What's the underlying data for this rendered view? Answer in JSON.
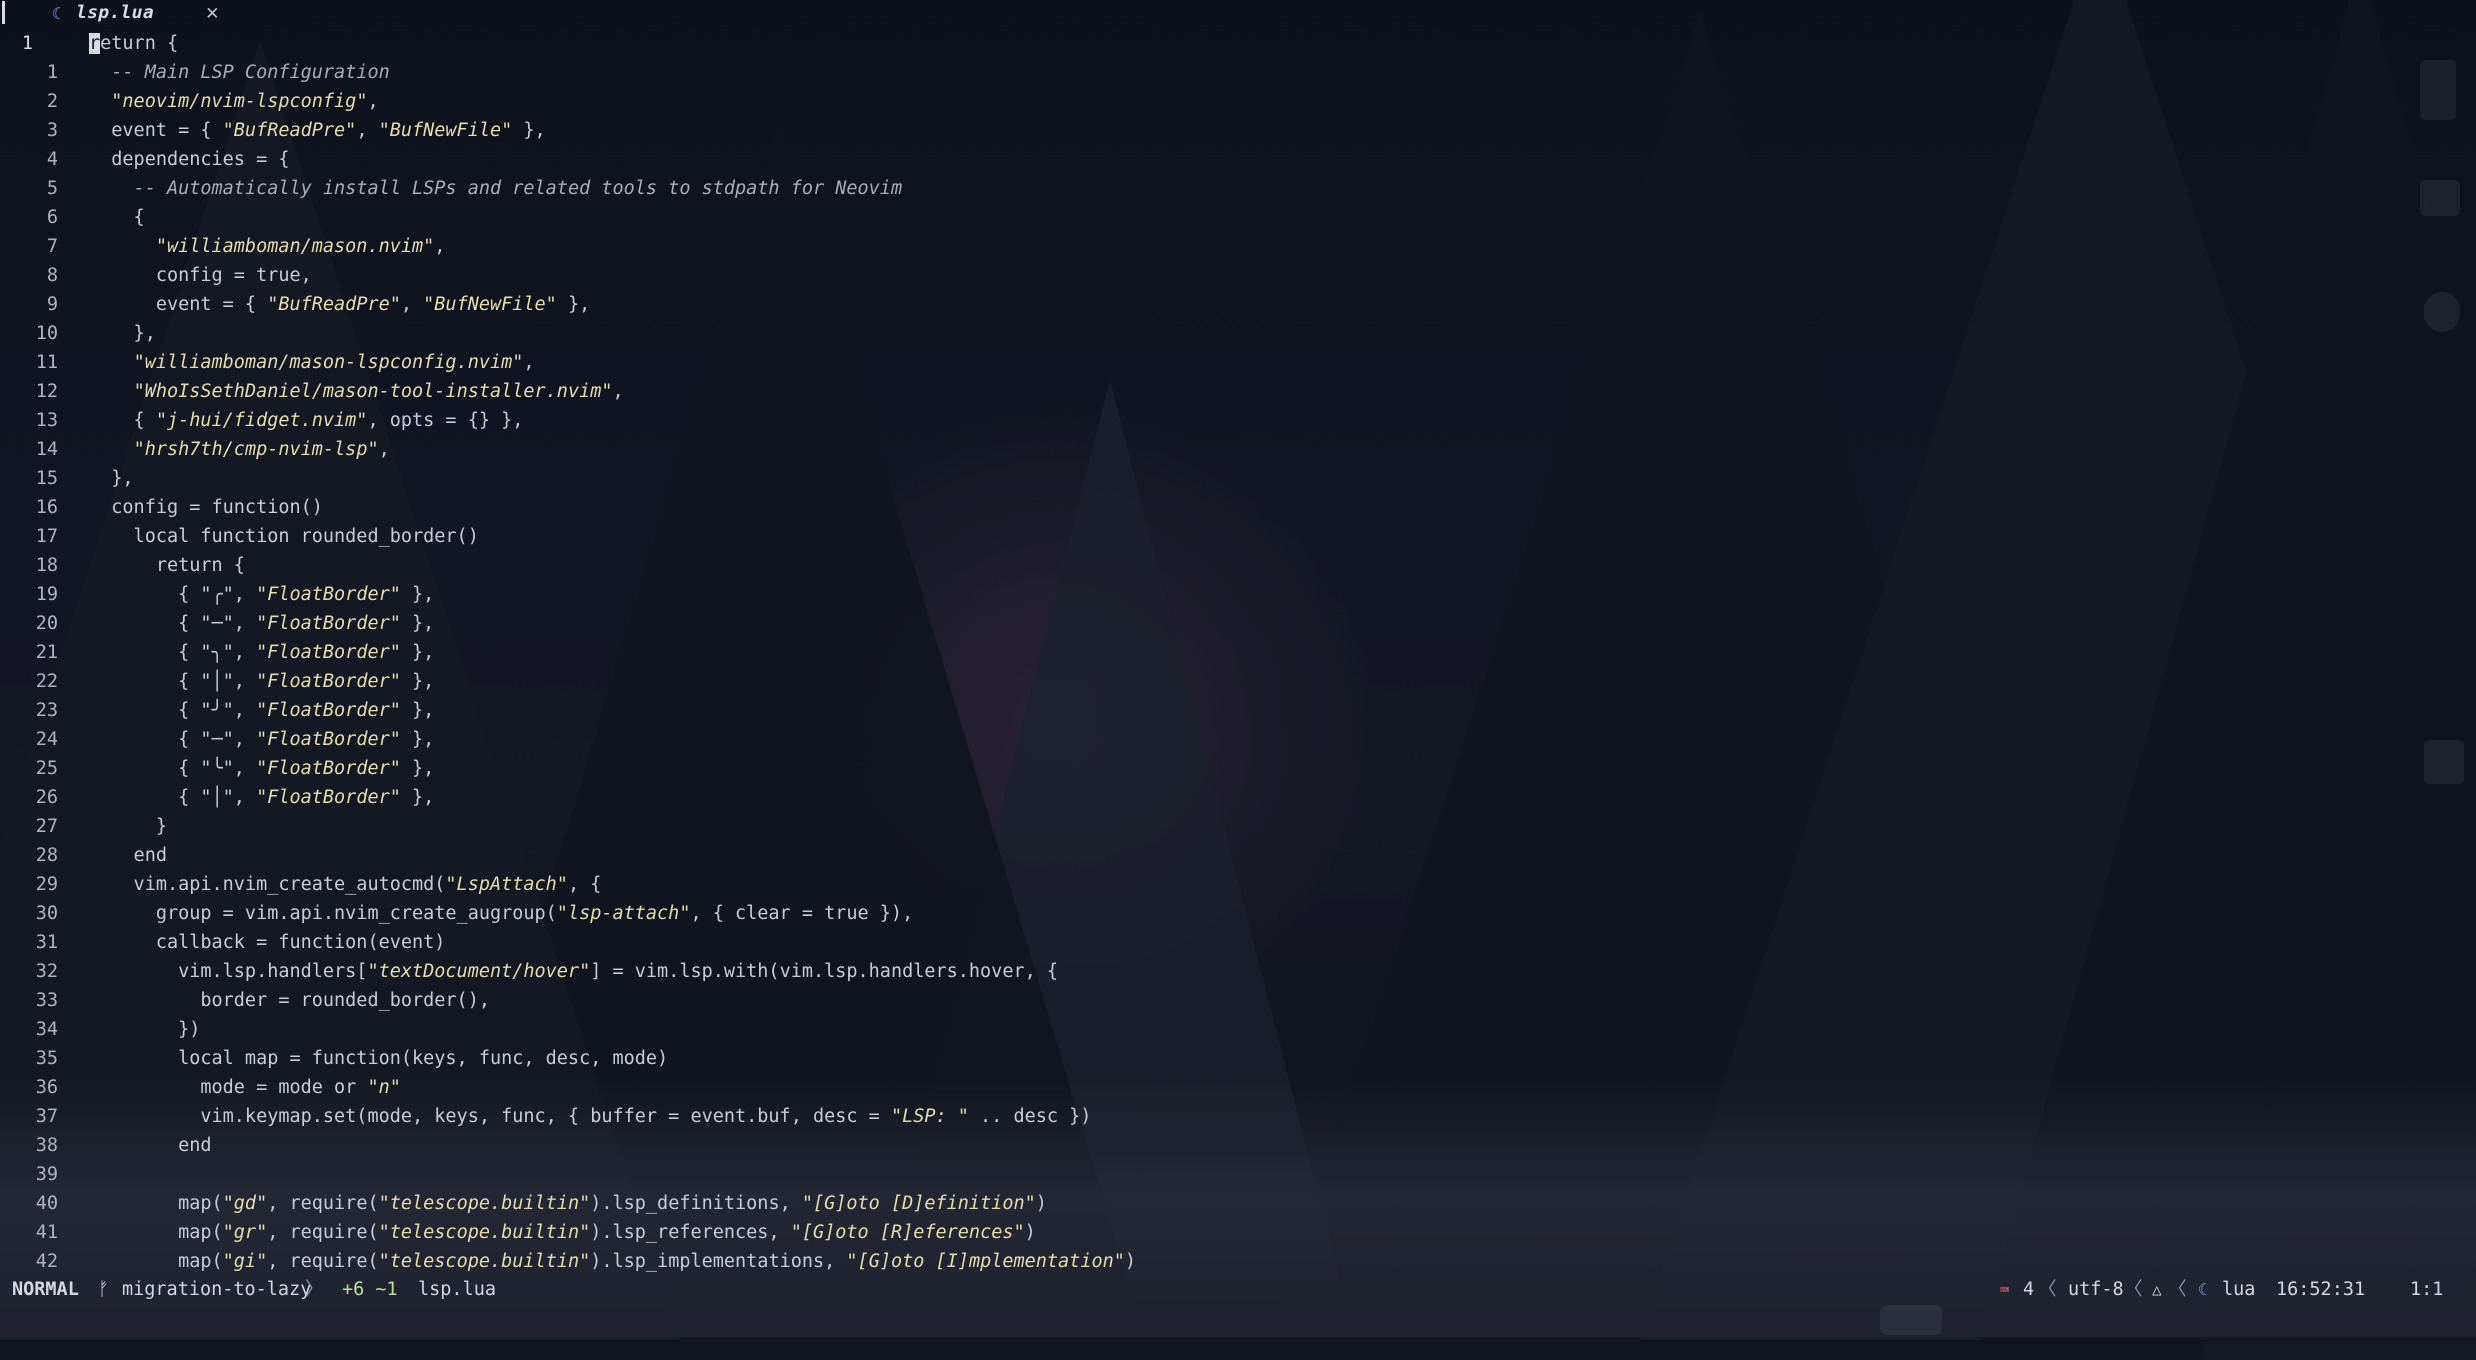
{
  "tab": {
    "icon": "lua-file-icon",
    "label": "lsp.lua",
    "close": "✕"
  },
  "editor": {
    "lines": [
      {
        "n": "1",
        "current": true,
        "segs": [
          {
            "t": "r",
            "k": "cursor"
          },
          {
            "t": "eturn {"
          }
        ]
      },
      {
        "n": "1",
        "segs": [
          {
            "t": "  "
          },
          {
            "t": "-- Main LSP Configuration",
            "k": "c"
          }
        ]
      },
      {
        "n": "2",
        "segs": [
          {
            "t": "  "
          },
          {
            "t": "\"neovim/nvim-lspconfig\"",
            "k": "s"
          },
          {
            "t": ","
          }
        ]
      },
      {
        "n": "3",
        "segs": [
          {
            "t": "  event = { "
          },
          {
            "t": "\"BufReadPre\"",
            "k": "s"
          },
          {
            "t": ", "
          },
          {
            "t": "\"BufNewFile\"",
            "k": "s"
          },
          {
            "t": " },"
          }
        ]
      },
      {
        "n": "4",
        "segs": [
          {
            "t": "  dependencies = {"
          }
        ]
      },
      {
        "n": "5",
        "segs": [
          {
            "t": "    "
          },
          {
            "t": "-- Automatically install LSPs and related tools to stdpath for Neovim",
            "k": "c"
          }
        ]
      },
      {
        "n": "6",
        "segs": [
          {
            "t": "    {"
          }
        ]
      },
      {
        "n": "7",
        "segs": [
          {
            "t": "      "
          },
          {
            "t": "\"williamboman/mason.nvim\"",
            "k": "s"
          },
          {
            "t": ","
          }
        ]
      },
      {
        "n": "8",
        "segs": [
          {
            "t": "      config = true,"
          }
        ]
      },
      {
        "n": "9",
        "segs": [
          {
            "t": "      event = { "
          },
          {
            "t": "\"BufReadPre\"",
            "k": "s"
          },
          {
            "t": ", "
          },
          {
            "t": "\"BufNewFile\"",
            "k": "s"
          },
          {
            "t": " },"
          }
        ]
      },
      {
        "n": "10",
        "segs": [
          {
            "t": "    },"
          }
        ]
      },
      {
        "n": "11",
        "segs": [
          {
            "t": "    "
          },
          {
            "t": "\"williamboman/mason-lspconfig.nvim\"",
            "k": "s"
          },
          {
            "t": ","
          }
        ]
      },
      {
        "n": "12",
        "segs": [
          {
            "t": "    "
          },
          {
            "t": "\"WhoIsSethDaniel/mason-tool-installer.nvim\"",
            "k": "s"
          },
          {
            "t": ","
          }
        ]
      },
      {
        "n": "13",
        "segs": [
          {
            "t": "    { "
          },
          {
            "t": "\"j-hui/fidget.nvim\"",
            "k": "s"
          },
          {
            "t": ", opts = {} },"
          }
        ]
      },
      {
        "n": "14",
        "segs": [
          {
            "t": "    "
          },
          {
            "t": "\"hrsh7th/cmp-nvim-lsp\"",
            "k": "s"
          },
          {
            "t": ","
          }
        ]
      },
      {
        "n": "15",
        "segs": [
          {
            "t": "  },"
          }
        ]
      },
      {
        "n": "16",
        "segs": [
          {
            "t": "  config = function()"
          }
        ]
      },
      {
        "n": "17",
        "segs": [
          {
            "t": "    local function rounded_border()"
          }
        ]
      },
      {
        "n": "18",
        "segs": [
          {
            "t": "      return {"
          }
        ]
      },
      {
        "n": "19",
        "segs": [
          {
            "t": "        { \"╭\", "
          },
          {
            "t": "\"FloatBorder\"",
            "k": "s"
          },
          {
            "t": " },"
          }
        ]
      },
      {
        "n": "20",
        "segs": [
          {
            "t": "        { \"─\", "
          },
          {
            "t": "\"FloatBorder\"",
            "k": "s"
          },
          {
            "t": " },"
          }
        ]
      },
      {
        "n": "21",
        "segs": [
          {
            "t": "        { \"╮\", "
          },
          {
            "t": "\"FloatBorder\"",
            "k": "s"
          },
          {
            "t": " },"
          }
        ]
      },
      {
        "n": "22",
        "segs": [
          {
            "t": "        { \"│\", "
          },
          {
            "t": "\"FloatBorder\"",
            "k": "s"
          },
          {
            "t": " },"
          }
        ]
      },
      {
        "n": "23",
        "segs": [
          {
            "t": "        { \"╯\", "
          },
          {
            "t": "\"FloatBorder\"",
            "k": "s"
          },
          {
            "t": " },"
          }
        ]
      },
      {
        "n": "24",
        "segs": [
          {
            "t": "        { \"─\", "
          },
          {
            "t": "\"FloatBorder\"",
            "k": "s"
          },
          {
            "t": " },"
          }
        ]
      },
      {
        "n": "25",
        "segs": [
          {
            "t": "        { \"╰\", "
          },
          {
            "t": "\"FloatBorder\"",
            "k": "s"
          },
          {
            "t": " },"
          }
        ]
      },
      {
        "n": "26",
        "segs": [
          {
            "t": "        { \"│\", "
          },
          {
            "t": "\"FloatBorder\"",
            "k": "s"
          },
          {
            "t": " },"
          }
        ]
      },
      {
        "n": "27",
        "segs": [
          {
            "t": "      }"
          }
        ]
      },
      {
        "n": "28",
        "segs": [
          {
            "t": "    end"
          }
        ]
      },
      {
        "n": "29",
        "segs": [
          {
            "t": "    vim.api.nvim_create_autocmd("
          },
          {
            "t": "\"LspAttach\"",
            "k": "s"
          },
          {
            "t": ", {"
          }
        ]
      },
      {
        "n": "30",
        "segs": [
          {
            "t": "      group = vim.api.nvim_create_augroup("
          },
          {
            "t": "\"lsp-attach\"",
            "k": "s"
          },
          {
            "t": ", { clear = true }),"
          }
        ]
      },
      {
        "n": "31",
        "segs": [
          {
            "t": "      callback = function(event)"
          }
        ]
      },
      {
        "n": "32",
        "segs": [
          {
            "t": "        vim.lsp.handlers["
          },
          {
            "t": "\"textDocument/hover\"",
            "k": "s"
          },
          {
            "t": "] = vim.lsp.with(vim.lsp.handlers.hover, {"
          }
        ]
      },
      {
        "n": "33",
        "segs": [
          {
            "t": "          border = rounded_border(),"
          }
        ]
      },
      {
        "n": "34",
        "segs": [
          {
            "t": "        })"
          }
        ]
      },
      {
        "n": "35",
        "segs": [
          {
            "t": "        local map = function(keys, func, desc, mode)"
          }
        ]
      },
      {
        "n": "36",
        "segs": [
          {
            "t": "          mode = mode or "
          },
          {
            "t": "\"n\"",
            "k": "s"
          }
        ]
      },
      {
        "n": "37",
        "segs": [
          {
            "t": "          vim.keymap.set(mode, keys, func, { buffer = event.buf, desc = "
          },
          {
            "t": "\"LSP: \"",
            "k": "s"
          },
          {
            "t": " .. desc })"
          }
        ]
      },
      {
        "n": "38",
        "segs": [
          {
            "t": "        end"
          }
        ]
      },
      {
        "n": "39",
        "segs": [
          {
            "t": ""
          }
        ]
      },
      {
        "n": "40",
        "segs": [
          {
            "t": "        map("
          },
          {
            "t": "\"gd\"",
            "k": "s"
          },
          {
            "t": ", require("
          },
          {
            "t": "\"telescope.builtin\"",
            "k": "s"
          },
          {
            "t": ").lsp_definitions, "
          },
          {
            "t": "\"[G]oto [D]efinition\"",
            "k": "s"
          },
          {
            "t": ")"
          }
        ]
      },
      {
        "n": "41",
        "segs": [
          {
            "t": "        map("
          },
          {
            "t": "\"gr\"",
            "k": "s"
          },
          {
            "t": ", require("
          },
          {
            "t": "\"telescope.builtin\"",
            "k": "s"
          },
          {
            "t": ").lsp_references, "
          },
          {
            "t": "\"[G]oto [R]eferences\"",
            "k": "s"
          },
          {
            "t": ")"
          }
        ]
      },
      {
        "n": "42",
        "segs": [
          {
            "t": "        map("
          },
          {
            "t": "\"gi\"",
            "k": "s"
          },
          {
            "t": ", require("
          },
          {
            "t": "\"telescope.builtin\"",
            "k": "s"
          },
          {
            "t": ").lsp_implementations, "
          },
          {
            "t": "\"[G]oto [I]mplementation\"",
            "k": "s"
          },
          {
            "t": ")"
          }
        ]
      }
    ]
  },
  "statusbar": {
    "mode": "NORMAL",
    "branch_icon": "git-branch-icon",
    "branch": "migration-to-lazy",
    "chevron": "〉",
    "diff": "+6 ~1",
    "filename": "lsp.lua",
    "indent_icon": "indent-icon",
    "indent": "4",
    "encoding": "utf-8",
    "format_icon": "linux-icon",
    "filetype_icon": "lua-file-icon",
    "filetype": "lua",
    "time": "16:52:31",
    "position": "1:1",
    "left_chevron": "〈"
  },
  "colors": {
    "string": "#e6dcb0",
    "comment": "#a9adba",
    "text": "#c8ccd8",
    "lua_icon": "#7aa2f7"
  }
}
